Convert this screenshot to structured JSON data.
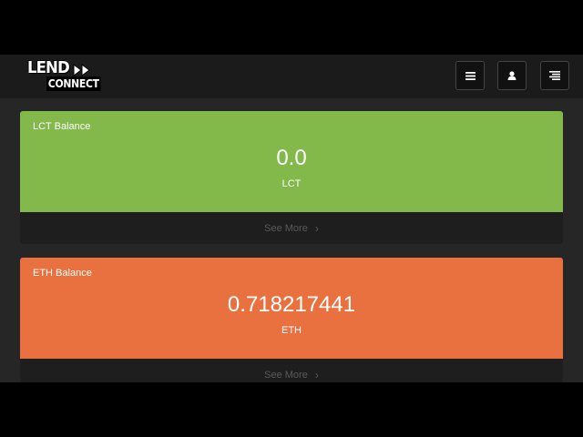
{
  "logo": {
    "line1": "LEND",
    "line2": "CONNECT",
    "arrows_icon": "fast-forward-icon"
  },
  "navbar": {
    "buttons": [
      {
        "icon": "hamburger-menu-icon"
      },
      {
        "icon": "user-icon"
      },
      {
        "icon": "list-icon"
      }
    ]
  },
  "cards": [
    {
      "label": "LCT Balance",
      "value": "0.0",
      "unit": "LCT",
      "footer": "See More",
      "color": "#83b84a"
    },
    {
      "label": "ETH Balance",
      "value": "0.718217441",
      "unit": "ETH",
      "footer": "See More",
      "color": "#e9703f"
    }
  ],
  "colors": {
    "background": "#262626",
    "navbar": "#1b1b1b",
    "card_footer": "#1e1e1e",
    "footer_text": "#5a5a5a"
  }
}
